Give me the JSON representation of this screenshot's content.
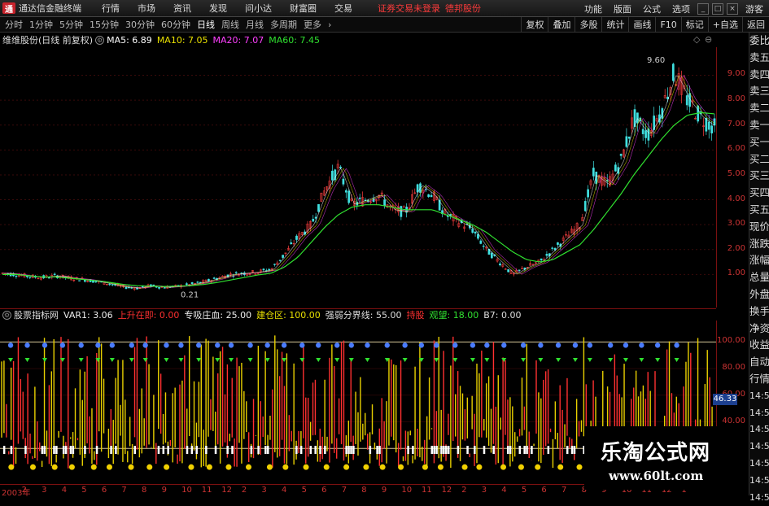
{
  "menubar": {
    "app_title": "通达信金融终端",
    "items": [
      "行情",
      "市场",
      "资讯",
      "发现",
      "问小达",
      "财富圈",
      "交易"
    ],
    "notice": "证券交易未登录",
    "notice2": "德邦股份",
    "right_items": [
      "功能",
      "版面",
      "公式",
      "选项"
    ],
    "guest": "游客"
  },
  "toolbar": {
    "periods": [
      "分时",
      "1分钟",
      "5分钟",
      "15分钟",
      "30分钟",
      "60分钟",
      "日线",
      "周线",
      "月线",
      "多周期",
      "更多"
    ],
    "active_period": "日线",
    "right_buttons": [
      "复权",
      "叠加",
      "多股",
      "统计",
      "画线",
      "F10",
      "标记",
      "+自选",
      "返回"
    ]
  },
  "info": {
    "stock": "维维股份(日线 前复权)",
    "ma5": "MA5: 6.89",
    "ma10": "MA10: 7.05",
    "ma20": "MA20: 7.07",
    "ma60": "MA60: 7.45",
    "colors": {
      "ma5": "#ffffff",
      "ma10": "#e8e000",
      "ma20": "#ff40ff",
      "ma60": "#30e030"
    }
  },
  "price_axis": [
    "9.00",
    "8.00",
    "7.00",
    "6.00",
    "5.00",
    "4.00",
    "3.00",
    "2.00",
    "1.00"
  ],
  "price_labels": {
    "high": "9.60",
    "low": "0.21"
  },
  "sidepanel": [
    "委比",
    "卖五",
    "卖四",
    "卖三",
    "卖二",
    "卖一",
    "买一",
    "买二",
    "买三",
    "买四",
    "买五",
    "现价",
    "涨跌",
    "涨幅",
    "总量",
    "外盘",
    "换手",
    "净资",
    "收益",
    "自动",
    "行情",
    "14:50",
    "14:50",
    "14:50",
    "14:50",
    "14:50",
    "14:50",
    "14:50"
  ],
  "indicator": {
    "name": "股票指标网",
    "var1": "VAR1: 3.06",
    "up": "上升在即: 0.00",
    "retail": "专吸庄血: 25.00",
    "build": "建仓区: 100.00",
    "boundary": "强弱分界线: 55.00",
    "hold": "持股",
    "watch": "观望: 18.00",
    "b7": "B7: 0.00"
  },
  "ind_axis": [
    "100.00",
    "80.00",
    "60.00",
    "40.00"
  ],
  "ind_current": "46.33",
  "dates": [
    "2003年",
    "2",
    "3",
    "4",
    "5",
    "6",
    "7",
    "8",
    "9",
    "10",
    "11",
    "12",
    "2",
    "3",
    "4",
    "5",
    "6",
    "7",
    "8",
    "9",
    "10",
    "11",
    "12",
    "2",
    "3",
    "4",
    "5",
    "6",
    "7",
    "8",
    "9",
    "10",
    "11",
    "12",
    "1"
  ],
  "watermark": {
    "title": "乐淘公式网",
    "url": "www.60lt.com"
  },
  "chart_data": {
    "type": "line",
    "title": "维维股份(日线 前复权)",
    "ylim": [
      0,
      9.8
    ],
    "series": [
      {
        "name": "K",
        "values": [
          1.05,
          1.0,
          0.92,
          0.88,
          0.95,
          0.85,
          0.8,
          0.72,
          0.62,
          0.5,
          0.45,
          0.55,
          0.48,
          0.52,
          0.6,
          0.7,
          0.85,
          1.0,
          1.05,
          1.1,
          1.2,
          1.8,
          2.5,
          3.0,
          4.4,
          5.3,
          3.8,
          4.0,
          4.2,
          3.6,
          3.5,
          4.6,
          4.2,
          3.4,
          3.1,
          2.8,
          2.0,
          1.5,
          1.0,
          1.3,
          1.5,
          2.0,
          2.5,
          3.0,
          5.0,
          4.6,
          5.5,
          7.3,
          6.6,
          7.5,
          9.1,
          8.0,
          7.3,
          6.9
        ]
      },
      {
        "name": "MA60",
        "values": [
          1.0,
          1.0,
          0.95,
          0.9,
          0.9,
          0.85,
          0.8,
          0.75,
          0.68,
          0.6,
          0.55,
          0.53,
          0.52,
          0.53,
          0.55,
          0.6,
          0.68,
          0.78,
          0.88,
          0.98,
          1.05,
          1.3,
          1.7,
          2.3,
          2.9,
          3.4,
          3.7,
          3.8,
          3.8,
          3.7,
          3.6,
          3.6,
          3.6,
          3.4,
          3.2,
          3.0,
          2.7,
          2.3,
          1.9,
          1.6,
          1.5,
          1.6,
          1.9,
          2.2,
          2.8,
          3.5,
          4.2,
          5.0,
          5.7,
          6.4,
          7.0,
          7.4,
          7.5,
          7.45
        ]
      }
    ]
  }
}
